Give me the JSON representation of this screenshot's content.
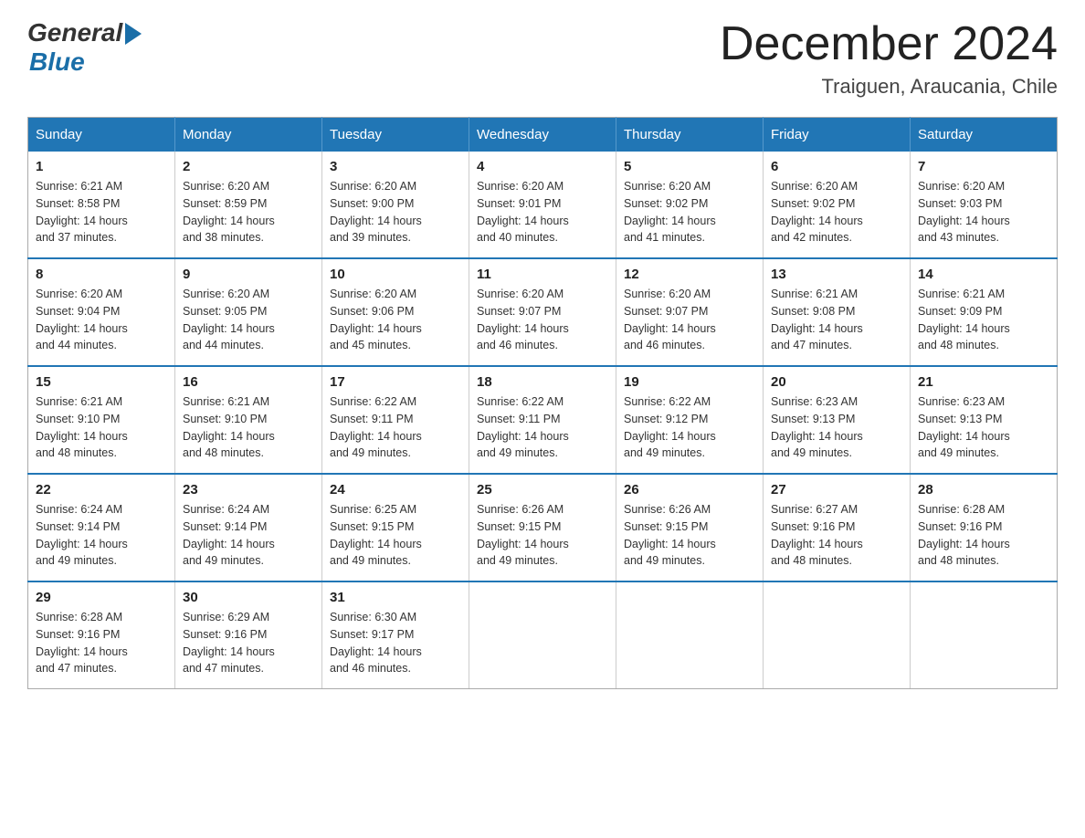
{
  "header": {
    "logo_general": "General",
    "logo_blue": "Blue",
    "month_title": "December 2024",
    "location": "Traiguen, Araucania, Chile"
  },
  "weekdays": [
    "Sunday",
    "Monday",
    "Tuesday",
    "Wednesday",
    "Thursday",
    "Friday",
    "Saturday"
  ],
  "weeks": [
    [
      {
        "day": "1",
        "sunrise": "6:21 AM",
        "sunset": "8:58 PM",
        "daylight": "14 hours and 37 minutes."
      },
      {
        "day": "2",
        "sunrise": "6:20 AM",
        "sunset": "8:59 PM",
        "daylight": "14 hours and 38 minutes."
      },
      {
        "day": "3",
        "sunrise": "6:20 AM",
        "sunset": "9:00 PM",
        "daylight": "14 hours and 39 minutes."
      },
      {
        "day": "4",
        "sunrise": "6:20 AM",
        "sunset": "9:01 PM",
        "daylight": "14 hours and 40 minutes."
      },
      {
        "day": "5",
        "sunrise": "6:20 AM",
        "sunset": "9:02 PM",
        "daylight": "14 hours and 41 minutes."
      },
      {
        "day": "6",
        "sunrise": "6:20 AM",
        "sunset": "9:02 PM",
        "daylight": "14 hours and 42 minutes."
      },
      {
        "day": "7",
        "sunrise": "6:20 AM",
        "sunset": "9:03 PM",
        "daylight": "14 hours and 43 minutes."
      }
    ],
    [
      {
        "day": "8",
        "sunrise": "6:20 AM",
        "sunset": "9:04 PM",
        "daylight": "14 hours and 44 minutes."
      },
      {
        "day": "9",
        "sunrise": "6:20 AM",
        "sunset": "9:05 PM",
        "daylight": "14 hours and 44 minutes."
      },
      {
        "day": "10",
        "sunrise": "6:20 AM",
        "sunset": "9:06 PM",
        "daylight": "14 hours and 45 minutes."
      },
      {
        "day": "11",
        "sunrise": "6:20 AM",
        "sunset": "9:07 PM",
        "daylight": "14 hours and 46 minutes."
      },
      {
        "day": "12",
        "sunrise": "6:20 AM",
        "sunset": "9:07 PM",
        "daylight": "14 hours and 46 minutes."
      },
      {
        "day": "13",
        "sunrise": "6:21 AM",
        "sunset": "9:08 PM",
        "daylight": "14 hours and 47 minutes."
      },
      {
        "day": "14",
        "sunrise": "6:21 AM",
        "sunset": "9:09 PM",
        "daylight": "14 hours and 48 minutes."
      }
    ],
    [
      {
        "day": "15",
        "sunrise": "6:21 AM",
        "sunset": "9:10 PM",
        "daylight": "14 hours and 48 minutes."
      },
      {
        "day": "16",
        "sunrise": "6:21 AM",
        "sunset": "9:10 PM",
        "daylight": "14 hours and 48 minutes."
      },
      {
        "day": "17",
        "sunrise": "6:22 AM",
        "sunset": "9:11 PM",
        "daylight": "14 hours and 49 minutes."
      },
      {
        "day": "18",
        "sunrise": "6:22 AM",
        "sunset": "9:11 PM",
        "daylight": "14 hours and 49 minutes."
      },
      {
        "day": "19",
        "sunrise": "6:22 AM",
        "sunset": "9:12 PM",
        "daylight": "14 hours and 49 minutes."
      },
      {
        "day": "20",
        "sunrise": "6:23 AM",
        "sunset": "9:13 PM",
        "daylight": "14 hours and 49 minutes."
      },
      {
        "day": "21",
        "sunrise": "6:23 AM",
        "sunset": "9:13 PM",
        "daylight": "14 hours and 49 minutes."
      }
    ],
    [
      {
        "day": "22",
        "sunrise": "6:24 AM",
        "sunset": "9:14 PM",
        "daylight": "14 hours and 49 minutes."
      },
      {
        "day": "23",
        "sunrise": "6:24 AM",
        "sunset": "9:14 PM",
        "daylight": "14 hours and 49 minutes."
      },
      {
        "day": "24",
        "sunrise": "6:25 AM",
        "sunset": "9:15 PM",
        "daylight": "14 hours and 49 minutes."
      },
      {
        "day": "25",
        "sunrise": "6:26 AM",
        "sunset": "9:15 PM",
        "daylight": "14 hours and 49 minutes."
      },
      {
        "day": "26",
        "sunrise": "6:26 AM",
        "sunset": "9:15 PM",
        "daylight": "14 hours and 49 minutes."
      },
      {
        "day": "27",
        "sunrise": "6:27 AM",
        "sunset": "9:16 PM",
        "daylight": "14 hours and 48 minutes."
      },
      {
        "day": "28",
        "sunrise": "6:28 AM",
        "sunset": "9:16 PM",
        "daylight": "14 hours and 48 minutes."
      }
    ],
    [
      {
        "day": "29",
        "sunrise": "6:28 AM",
        "sunset": "9:16 PM",
        "daylight": "14 hours and 47 minutes."
      },
      {
        "day": "30",
        "sunrise": "6:29 AM",
        "sunset": "9:16 PM",
        "daylight": "14 hours and 47 minutes."
      },
      {
        "day": "31",
        "sunrise": "6:30 AM",
        "sunset": "9:17 PM",
        "daylight": "14 hours and 46 minutes."
      },
      null,
      null,
      null,
      null
    ]
  ],
  "labels": {
    "sunrise": "Sunrise:",
    "sunset": "Sunset:",
    "daylight": "Daylight:"
  }
}
